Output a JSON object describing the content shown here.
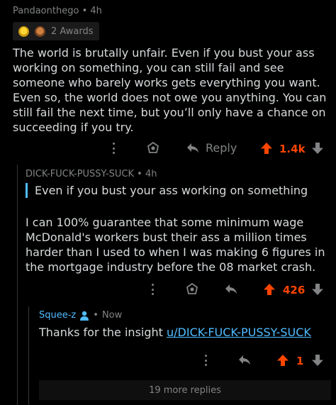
{
  "colors": {
    "background": "#000000",
    "text": "#d7dadc",
    "muted": "#818384",
    "upvote": "#ff4500",
    "link": "#4fbcff",
    "thread_line": "#343536"
  },
  "comment1": {
    "author": "Pandaonthego",
    "age": "4h",
    "awards_label": "2 Awards",
    "award_icons": [
      "gold-award-icon",
      "bear-award-icon"
    ],
    "body": "The world is brutally unfair. Even if you bust your ass working on something, you can still fail and see someone who barely works gets everything you want. Even so, the world does not owe you anything. You can still fail the next time, but you’ll only have a chance on succeeding if you try.",
    "reply_label": "Reply",
    "score": "1.4k"
  },
  "comment2": {
    "author": "DICK-FUCK-PUSSY-SUCK",
    "age": "4h",
    "quote": "Even if you bust your ass working on something",
    "body": "I can 100% guarantee that some minimum wage McDonald's workers bust their ass a million times harder than I used to when I was making 6 figures in the mortgage industry before the 08 market crash.",
    "score": "426"
  },
  "comment3": {
    "author": "Squee-z",
    "age": "Now",
    "body_prefix": "Thanks for the insight ",
    "link": "u/DICK-FUCK-PUSSY-SUCK",
    "score": "1"
  },
  "more_replies": "19 more replies"
}
